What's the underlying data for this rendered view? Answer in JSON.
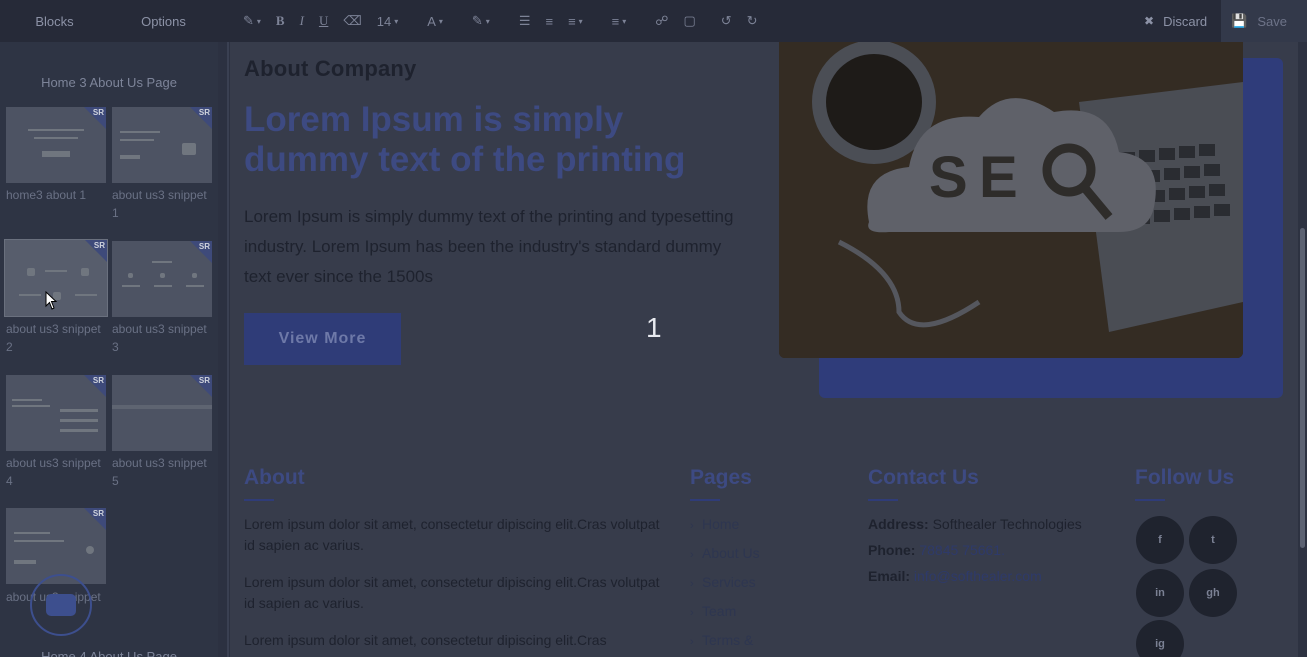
{
  "toolbar": {
    "tabs": [
      "Blocks",
      "Options"
    ],
    "font_size": "14",
    "discard_label": "Discard",
    "save_label": "Save"
  },
  "sidebar": {
    "heading": "Home 3 About Us Page",
    "thumbnails": [
      {
        "label": "home3 about 1",
        "badge": "SR"
      },
      {
        "label": "about us3 snippet 1",
        "badge": "SR"
      },
      {
        "label": "about us3 snippet 2",
        "badge": "SR"
      },
      {
        "label": "about us3 snippet 3",
        "badge": "SR"
      },
      {
        "label": "about us3 snippet 4",
        "badge": "SR"
      },
      {
        "label": "about us3 snippet 5",
        "badge": "SR"
      },
      {
        "label": "about us3 snippet",
        "badge": "SR"
      }
    ],
    "next_heading": "Home 4 About Us Page"
  },
  "content": {
    "section_title": "About Company",
    "hero_title": "Lorem Ipsum is simply dummy text of the printing",
    "hero_text": "Lorem Ipsum is simply dummy text of the printing and typesetting industry. Lorem Ipsum has been the industry's standard dummy text ever since the 1500s",
    "button_label": "View More",
    "overlay_number": "1"
  },
  "footer": {
    "about": {
      "title": "About",
      "paragraphs": [
        "Lorem ipsum dolor sit amet, consectetur dipiscing elit.Cras volutpat id sapien ac varius.",
        "Lorem ipsum dolor sit amet, consectetur dipiscing elit.Cras volutpat id sapien ac varius.",
        "Lorem ipsum dolor sit amet, consectetur dipiscing elit.Cras"
      ]
    },
    "pages": {
      "title": "Pages",
      "links": [
        "Home",
        "About Us",
        "Services",
        "Team",
        "Terms &"
      ]
    },
    "contact": {
      "title": "Contact Us",
      "address_label": "Address:",
      "address_value": "Softhealer Technologies",
      "phone_label": "Phone:",
      "phone_value": "78845 75661.",
      "email_label": "Email:",
      "email_value": "info@softhealer.com"
    },
    "follow": {
      "title": "Follow Us",
      "icons": [
        "f",
        "t",
        "in",
        "gh",
        "ig"
      ]
    }
  },
  "colors": {
    "accent": "#3d4a82",
    "toolbar_bg": "#262a38",
    "sidebar_bg": "#2e3444",
    "overlay_dim": "#373c4b"
  }
}
